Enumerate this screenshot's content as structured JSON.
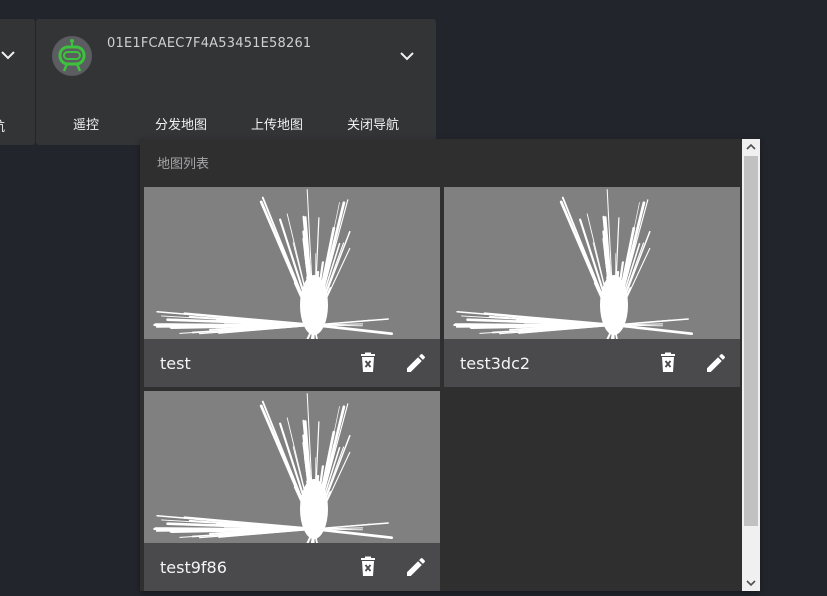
{
  "left_card": {
    "action_partial": "航"
  },
  "robot_card": {
    "id": "01E1FCAEC7F4A53451E58261",
    "actions": [
      "遥控",
      "分发地图",
      "上传地图",
      "关闭导航"
    ]
  },
  "map_list": {
    "title": "地图列表",
    "maps": [
      {
        "name": "test"
      },
      {
        "name": "test3dc2"
      },
      {
        "name": "test9f86"
      }
    ]
  },
  "colors": {
    "background": "#23252d",
    "card": "#333436",
    "panel": "#2f2f30",
    "avatar_accent": "#3cc23c"
  },
  "icons": {
    "expand": "chevron-down-icon",
    "robot": "robot-icon",
    "delete": "trash-icon",
    "edit": "pencil-icon"
  }
}
